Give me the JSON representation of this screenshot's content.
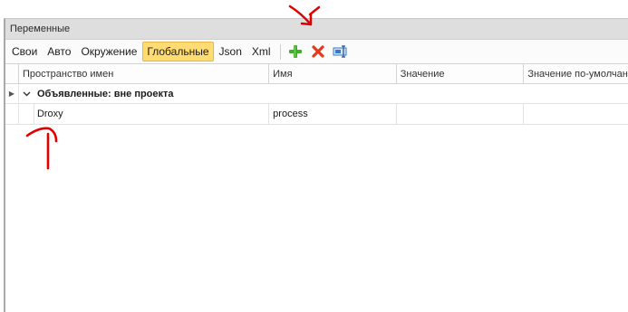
{
  "panel": {
    "title": "Переменные"
  },
  "toolbar": {
    "tabs": [
      {
        "label": "Свои"
      },
      {
        "label": "Авто"
      },
      {
        "label": "Окружение"
      },
      {
        "label": "Глобальные",
        "active": true
      },
      {
        "label": "Json"
      },
      {
        "label": "Xml"
      }
    ],
    "buttons": {
      "add_icon": "plus-icon",
      "delete_icon": "delete-x-icon",
      "edit_icon": "rename-icon"
    }
  },
  "grid": {
    "columns": [
      "Пространство имен",
      "Имя",
      "Значение",
      "Значение по-умолчан"
    ],
    "group": {
      "label": "Объявленные: вне проекта"
    },
    "rows": [
      {
        "namespace": "Droxy",
        "name": "process",
        "value": "",
        "default": ""
      }
    ]
  },
  "colors": {
    "active_tab": "#ffdc71",
    "annotation": "#e10000"
  }
}
